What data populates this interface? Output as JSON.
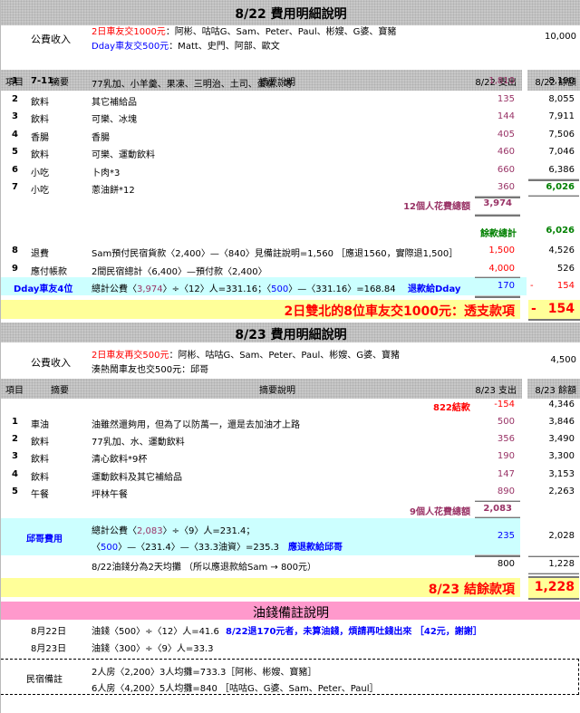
{
  "day1": {
    "title": "8/22 費用明細說明",
    "income_label": "公費收入",
    "income_line1_red": "2日車友交1000元",
    "income_line1_rest": "：阿彬、咕咕G、Sam、Peter、Paul、彬嫂、G婆、寶豬",
    "income_line2_blue": "Dday車友交500元",
    "income_line2_rest": "：Matt、史門、阿部、歐文",
    "income_amount": "10,000",
    "headers": {
      "no": "項目",
      "summary": "摘要",
      "desc": "摘要說明",
      "expense": "8/22 支出",
      "balance": "8/22 餘額"
    },
    "items": [
      {
        "no": "1",
        "summary": "7-11.",
        "desc": "77乳加、小羊羹、果凍、三明治、土司、蛋糕...等",
        "expense": "1,810",
        "balance": "8,190"
      },
      {
        "no": "2",
        "summary": "飲料",
        "desc": "其它補給品",
        "expense": "135",
        "balance": "8,055"
      },
      {
        "no": "3",
        "summary": "飲料",
        "desc": "可樂、冰塊",
        "expense": "144",
        "balance": "7,911"
      },
      {
        "no": "4",
        "summary": "香腸",
        "desc": "香腸",
        "expense": "405",
        "balance": "7,506"
      },
      {
        "no": "5",
        "summary": "飲料",
        "desc": "可樂、運動飲料",
        "expense": "460",
        "balance": "7,046"
      },
      {
        "no": "6",
        "summary": "小吃",
        "desc": "卜肉*3",
        "expense": "660",
        "balance": "6,386"
      },
      {
        "no": "7",
        "summary": "小吃",
        "desc": "蔥油餅*12",
        "expense": "360",
        "balance": "6,026"
      }
    ],
    "total_label": "12個人花費總額",
    "total_value": "3,974",
    "remain_label": "餘款總計",
    "remain_value": "6,026",
    "items2": [
      {
        "no": "8",
        "summary": "退費",
        "desc": "Sam預付民宿貨款〈2,400〉—〈840〉見備註說明=1,560 ［應退1560，實際退1,500］",
        "expense": "1,500",
        "balance": "4,526"
      },
      {
        "no": "9",
        "summary": "應付帳款",
        "desc": "2間民宿總計〈6,400〉—預付款〈2,400〉",
        "expense": "4,000",
        "balance": "526"
      }
    ],
    "dday": {
      "label": "Dday車友4位",
      "f1": "總計公費〈",
      "f2": "3,974",
      "f3": "〉÷〈12〉人=331.16；〈",
      "f4": "500",
      "f5": "〉—〈331.16〉=168.84",
      "refund": "退款給Dday",
      "expense": "170",
      "sign": "-",
      "balance": "154"
    },
    "summary_text": "2日雙北的8位車友交1000元：透支款項",
    "summary_sign": "-",
    "summary_value": "154"
  },
  "day2": {
    "title": "8/23 費用明細說明",
    "income_label": "公費收入",
    "income_line1_red": "2日車友再交500元",
    "income_line1_rest": "：阿彬、咕咕G、Sam、Peter、Paul、彬嫂、G婆、寶豬",
    "income_line2": "湊熱鬧車友也交500元：邱哥",
    "income_amount": "4,500",
    "headers": {
      "no": "項目",
      "summary": "摘要",
      "desc": "摘要說明",
      "expense": "8/23 支出",
      "balance": "8/23 餘額"
    },
    "carry_label": "822結款",
    "carry_expense": "-154",
    "carry_balance": "4,346",
    "items": [
      {
        "no": "1",
        "summary": "車油",
        "desc": "油雖然還夠用，但為了以防萬一，還是去加油才上路",
        "expense": "500",
        "balance": "3,846"
      },
      {
        "no": "2",
        "summary": "飲料",
        "desc": "77乳加、水、運動飲料",
        "expense": "356",
        "balance": "3,490"
      },
      {
        "no": "3",
        "summary": "飲料",
        "desc": "清心飲料*9杯",
        "expense": "190",
        "balance": "3,300"
      },
      {
        "no": "4",
        "summary": "飲料",
        "desc": "運動飲料及其它補給品",
        "expense": "147",
        "balance": "3,153"
      },
      {
        "no": "5",
        "summary": "午餐",
        "desc": "坪林午餐",
        "expense": "890",
        "balance": "2,263"
      }
    ],
    "total_label": "9個人花費總額",
    "total_value": "2,083",
    "qiu": {
      "label": "邱哥費用",
      "a1": "總計公費〈",
      "a2": "2,083",
      "a3": "〉÷〈9〉人=231.4；",
      "b1": "〈",
      "b2": "500",
      "b3": "〉—〈231.4〉—〈33.3油資〉=235.3",
      "refund": "應退款給邱哥",
      "expense": "235",
      "balance": "2,028"
    },
    "oil_row": {
      "desc": "8/22油錢分為2天均攤 （所以應退款給Sam → 800元）",
      "expense": "800",
      "balance": "1,228"
    },
    "summary_text": "8/23 結餘款項",
    "summary_value": "1,228"
  },
  "notes": {
    "title": "油錢備註說明",
    "rows": [
      {
        "date": "8月22日",
        "text": "油錢〈500〉÷〈12〉人=41.6",
        "note": "8/22退170元者，未算油錢，煩請再吐錢出來 ［42元，謝謝］"
      },
      {
        "date": "8月23日",
        "text": "油錢〈300〉÷〈9〉人=33.3"
      }
    ],
    "lodging_label": "民宿備註",
    "lodging": [
      "2人房〈2,200〉3人均攤=733.3［阿彬、彬嫂、寶豬］",
      "6人房〈4,200〉5人均攤=840 ［咕咕G、G婆、Sam、Peter、Paul］"
    ]
  },
  "colors": {
    "expense": "#993366",
    "red": "#ff0000",
    "blue": "#0000ff",
    "green": "#008000",
    "cyan": "#ccffff",
    "yellow": "#ffff99",
    "pink": "#ff99cc"
  }
}
